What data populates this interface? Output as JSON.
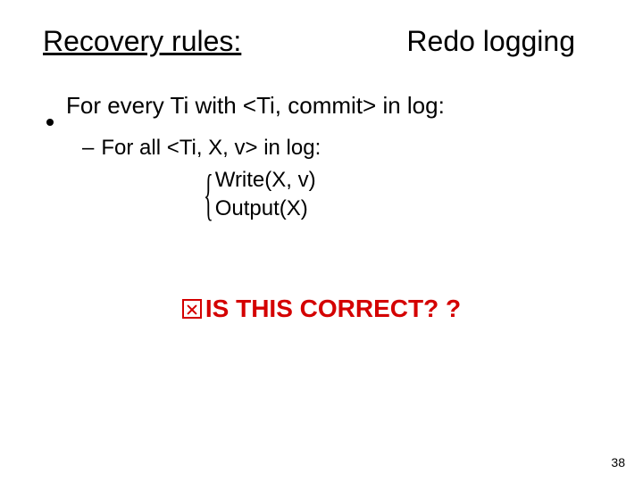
{
  "header": {
    "title_left": "Recovery rules:",
    "title_right": "Redo logging"
  },
  "bullet": {
    "text": "For every Ti with <Ti, commit> in log:"
  },
  "subbullet": {
    "text": "For all <Ti, X, v> in log:"
  },
  "brace_block": {
    "line1": "Write(X, v)",
    "line2": "Output(X)"
  },
  "question": {
    "text": "IS THIS CORRECT? ?"
  },
  "page_number": "38",
  "colors": {
    "accent_red": "#d40000"
  }
}
